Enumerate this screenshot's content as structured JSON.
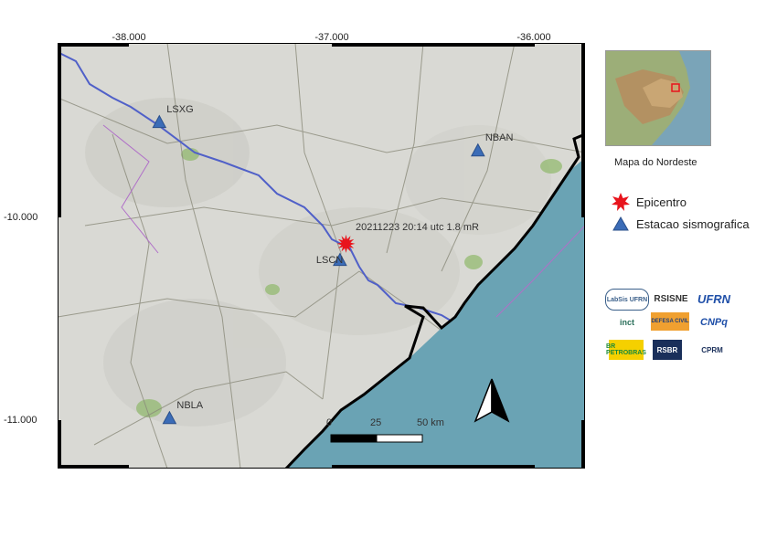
{
  "axes": {
    "x_ticks": [
      "-38.000",
      "-37.000",
      "-36.000"
    ],
    "y_ticks": [
      "-10.000",
      "-11.000"
    ]
  },
  "event": {
    "label": "20211223 20:14 utc 1.8 mR",
    "lon": -36.93,
    "lat": -10.13
  },
  "stations": [
    {
      "code": "LSXG",
      "lon": -37.85,
      "lat": -9.53
    },
    {
      "code": "NBAN",
      "lon": -36.28,
      "lat": -9.67
    },
    {
      "code": "LSCN",
      "lon": -36.96,
      "lat": -10.21
    },
    {
      "code": "NBLA",
      "lon": -37.8,
      "lat": -10.99
    }
  ],
  "scale_bar": {
    "labels": [
      "0",
      "25",
      "50 km"
    ]
  },
  "inset": {
    "caption": "Mapa do Nordeste"
  },
  "legend": {
    "epicenter": "Epicentro",
    "station": "Estacao sismografica"
  },
  "logos": {
    "labsis": "LabSis UFRN",
    "rsisne": "RSISNE",
    "ufrn": "UFRN",
    "inct": "inct",
    "defesa": "DEFESA CIVIL",
    "cnpq": "CNPq",
    "br": "BR PETROBRAS",
    "rsbr": "RSBR",
    "cprm": "CPRM"
  },
  "colors": {
    "ocean": "#6aa3b4",
    "land": "#d9d9d4",
    "epicenter": "#e8141c",
    "station": "#3b6cb7",
    "river": "#5060c8",
    "coastline": "#000000"
  }
}
